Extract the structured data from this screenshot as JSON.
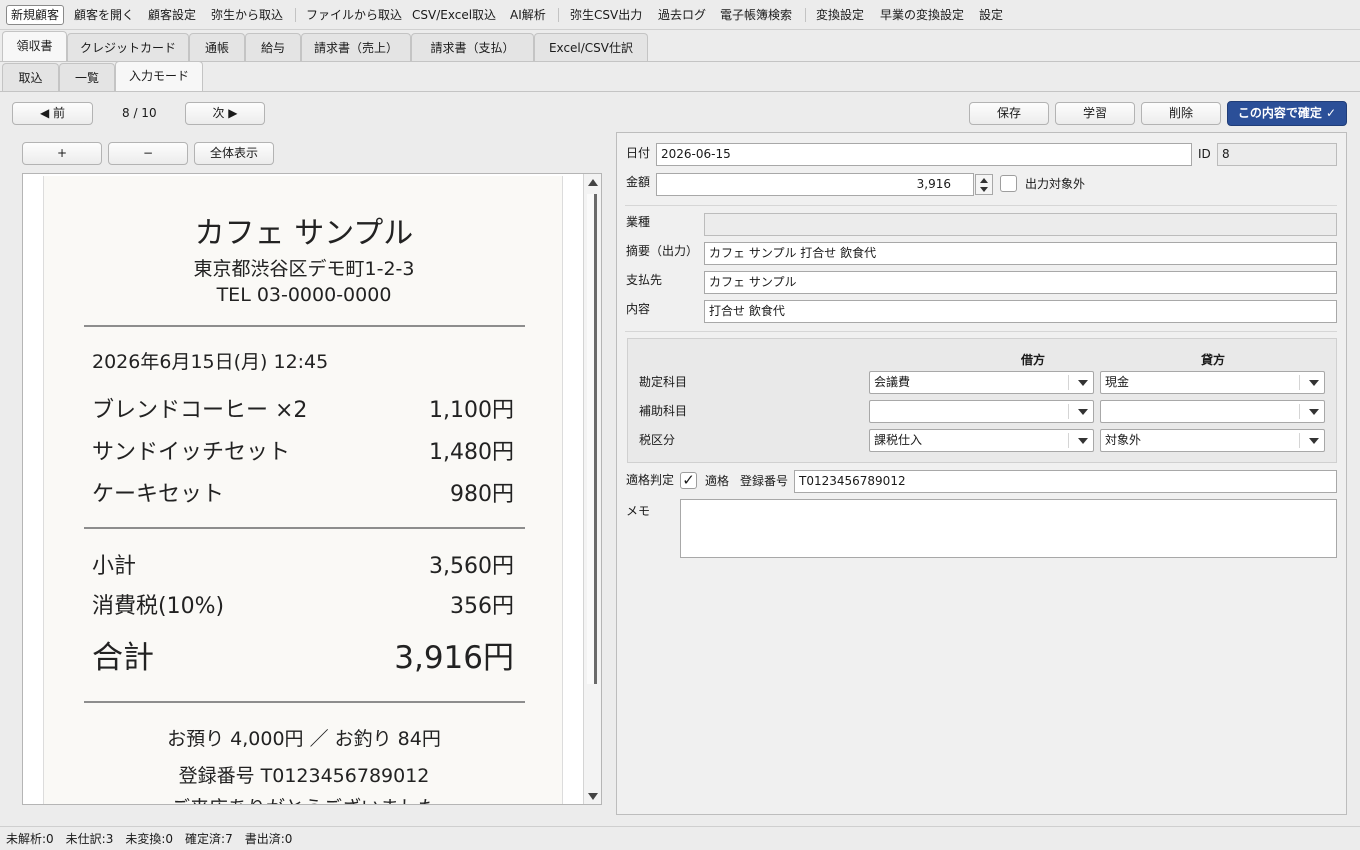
{
  "menu": {
    "items": [
      "新規顧客",
      "顧客を開く",
      "顧客設定",
      "弥生から取込",
      "ファイルから取込",
      "CSV/Excel取込",
      "AI解析",
      "弥生CSV出力",
      "過去ログ",
      "電子帳簿検索",
      "変換設定",
      "早業の変換設定",
      "設定"
    ]
  },
  "tabs": {
    "main": [
      "領収書",
      "クレジットカード",
      "通帳",
      "給与",
      "請求書（売上）",
      "請求書（支払）",
      "Excel/CSV仕訳"
    ],
    "sub": [
      "取込",
      "一覧",
      "入力モード"
    ]
  },
  "nav": {
    "prev": "◀ 前",
    "counter": "8 / 10",
    "next": "次 ▶"
  },
  "actions": {
    "save": "保存",
    "learn": "学習",
    "delete": "削除",
    "confirm": "この内容で確定 ✓"
  },
  "viewer": {
    "zoom_in": "+",
    "zoom_out": "−",
    "fit": "全体表示"
  },
  "receipt": {
    "shop": "カフェ サンプル",
    "address": "東京都渋谷区デモ町1-2-3",
    "tel": "TEL 03-0000-0000",
    "datetime": "2026年6月15日(月) 12:45",
    "items": [
      {
        "name": "ブレンドコーヒー ×2",
        "price": "1,100円"
      },
      {
        "name": "サンドイッチセット",
        "price": "1,480円"
      },
      {
        "name": "ケーキセット",
        "price": "980円"
      }
    ],
    "subtotal_label": "小計",
    "subtotal": "3,560円",
    "tax_label": "消費税(10%)",
    "tax": "356円",
    "total_label": "合計",
    "total": "3,916円",
    "change_line": "お預り 4,000円 ／ お釣り 84円",
    "reg_line": "登録番号 T0123456789012",
    "thanks_line": "ご来店ありがとうございました"
  },
  "form": {
    "date_label": "日付",
    "date": "2026-06-15",
    "id_label": "ID",
    "id": "8",
    "amount_label": "金額",
    "amount": "3,916",
    "exclude_label": "出力対象外",
    "industry_label": "業種",
    "industry": "",
    "summary_label": "摘要（出力）",
    "summary": "カフェ サンプル 打合せ 飲食代",
    "payee_label": "支払先",
    "payee": "カフェ サンプル",
    "content_label": "内容",
    "content": "打合せ 飲食代",
    "debit_header": "借方",
    "credit_header": "貸方",
    "account_label": "勘定科目",
    "debit_account": "会議費",
    "credit_account": "現金",
    "sub_account_label": "補助科目",
    "debit_sub": "",
    "credit_sub": "",
    "tax_class_label": "税区分",
    "debit_tax": "課税仕入",
    "credit_tax": "対象外",
    "qualified_label": "適格判定",
    "qualified_check_label": "適格",
    "qualified_checked": true,
    "reg_no_label": "登録番号",
    "reg_no": "T0123456789012",
    "memo_label": "メモ",
    "memo": ""
  },
  "status": "未解析:0　未仕訳:3　未変換:0　確定済:7　書出済:0"
}
